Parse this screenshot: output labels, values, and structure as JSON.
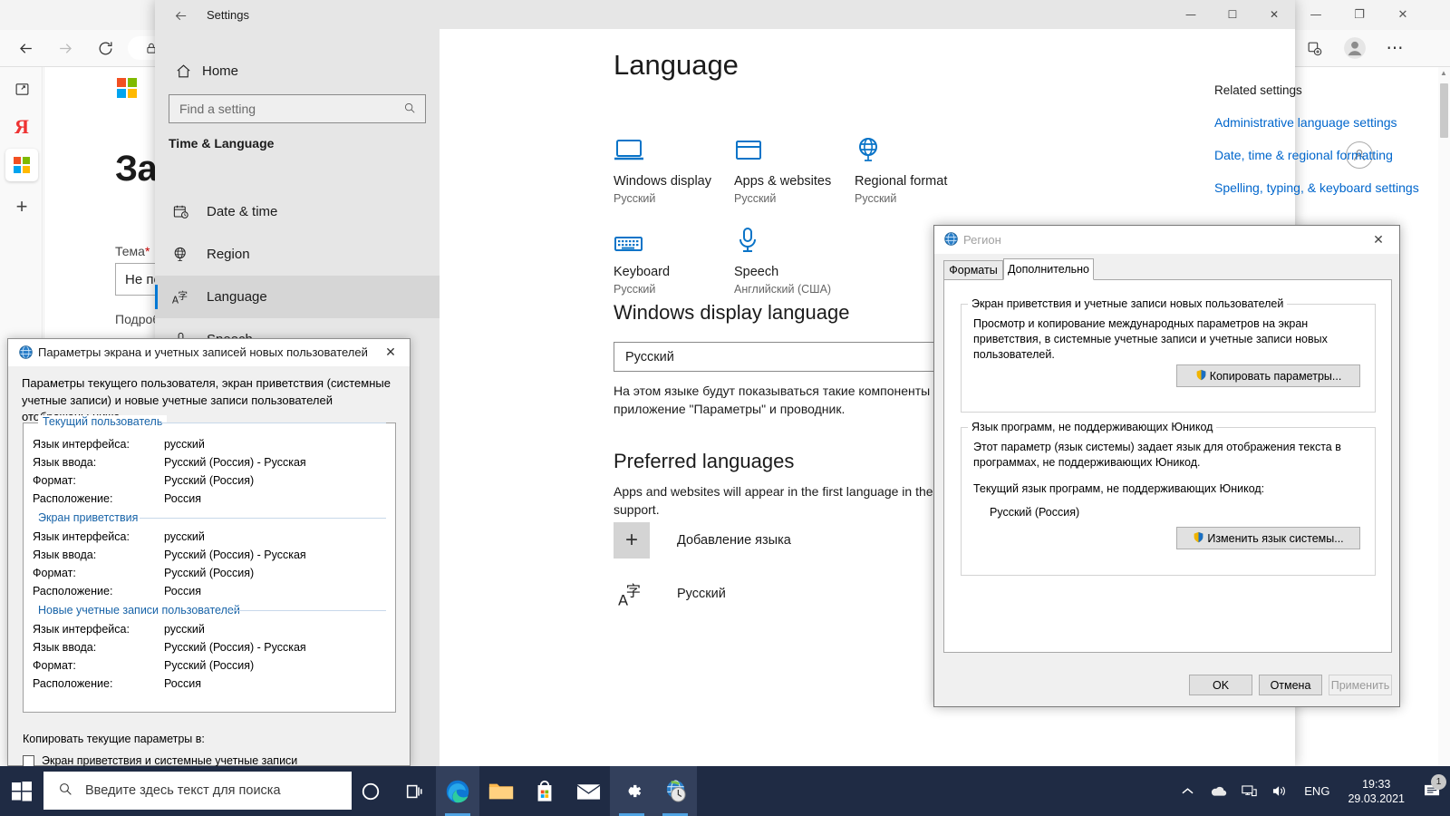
{
  "browser": {
    "back_icon": "back-arrow-icon",
    "forward_icon": "forward-arrow-icon",
    "reload_icon": "reload-icon",
    "lock_icon": "lock-icon",
    "rail": [
      {
        "name": "tab-list-icon",
        "label": ""
      },
      {
        "name": "yandex-tab-icon",
        "label": "Я"
      },
      {
        "name": "microsoft-tab-icon",
        "label": ""
      },
      {
        "name": "new-tab-icon",
        "label": "+"
      }
    ],
    "page": {
      "heading": "Зад",
      "field_label": "Тема",
      "field_required_mark": "*",
      "field_value": "Не по",
      "details_label": "Подроб"
    },
    "collections_icon": "collections-icon",
    "profile_icon": "profile-icon",
    "more_icon": "more-options-icon",
    "minimize": "—",
    "maximize": "❐",
    "close": "✕"
  },
  "settings": {
    "titlebar": {
      "back_label": "←",
      "title": "Settings",
      "minimize": "—",
      "maximize": "☐",
      "close": "✕"
    },
    "sidebar": {
      "home_label": "Home",
      "search_placeholder": "Find a setting",
      "group_header": "Time & Language",
      "items": [
        {
          "label": "Date & time",
          "icon": "calendar-clock-icon",
          "active": false
        },
        {
          "label": "Region",
          "icon": "globe-icon",
          "active": false
        },
        {
          "label": "Language",
          "icon": "language-icon",
          "active": true
        },
        {
          "label": "Speech",
          "icon": "microphone-icon",
          "active": false
        }
      ]
    },
    "page_title": "Language",
    "cards": [
      {
        "name": "Windows display",
        "value": "Русский",
        "icon": "monitor-icon"
      },
      {
        "name": "Apps & websites",
        "value": "Русский",
        "icon": "window-icon"
      },
      {
        "name": "Regional format",
        "value": "Русский",
        "icon": "globe-icon"
      },
      {
        "name": "Keyboard",
        "value": "Русский",
        "icon": "keyboard-icon"
      },
      {
        "name": "Speech",
        "value": "Английский (США)",
        "icon": "microphone-icon"
      }
    ],
    "display_language": {
      "heading": "Windows display language",
      "selected": "Русский",
      "chevron": "chevron-down-icon",
      "description": "На этом языке будут показываться такие компоненты Windows, как приложение \"Параметры\" и проводник."
    },
    "preferred_languages": {
      "heading": "Preferred languages",
      "description": "Apps and websites will appear in the first language in the list that they support.",
      "add_label": "Добавление языка",
      "add_icon": "plus-icon",
      "language_row": {
        "label": "Русский",
        "icon": "language-icon",
        "action_icons": [
          "language-pack-icon",
          "display-language-icon",
          "handwriting-icon",
          "spellcheck-icon"
        ]
      }
    },
    "related": {
      "heading": "Related settings",
      "links": [
        "Administrative language settings",
        "Date, time & regional formatting",
        "Spelling, typing, & keyboard settings"
      ]
    }
  },
  "users_dialog": {
    "title": "Параметры экрана и учетных записей новых пользователей",
    "icon": "region-globe-icon",
    "close": "✕",
    "intro": "Параметры текущего пользователя, экран приветствия (системные учетные записи) и новые учетные записи пользователей отображены ниже.",
    "groups": [
      {
        "title": "Текущий пользователь",
        "rows": [
          {
            "key": "Язык интерфейса:",
            "value": "русский"
          },
          {
            "key": "Язык ввода:",
            "value": "Русский (Россия) - Русская"
          },
          {
            "key": "Формат:",
            "value": "Русский (Россия)"
          },
          {
            "key": "Расположение:",
            "value": "Россия"
          }
        ]
      },
      {
        "title": "Экран приветствия",
        "rows": [
          {
            "key": "Язык интерфейса:",
            "value": "русский"
          },
          {
            "key": "Язык ввода:",
            "value": "Русский (Россия) - Русская"
          },
          {
            "key": "Формат:",
            "value": "Русский (Россия)"
          },
          {
            "key": "Расположение:",
            "value": "Россия"
          }
        ]
      },
      {
        "title": "Новые учетные записи пользователей",
        "rows": [
          {
            "key": "Язык интерфейса:",
            "value": "русский"
          },
          {
            "key": "Язык ввода:",
            "value": "Русский (Россия) - Русская"
          },
          {
            "key": "Формат:",
            "value": "Русский (Россия)"
          },
          {
            "key": "Расположение:",
            "value": "Россия"
          }
        ]
      }
    ],
    "copy_label": "Копировать текущие параметры в:",
    "checkbox_label": "Экран приветствия и системные учетные записи"
  },
  "region_dialog": {
    "title": "Регион",
    "icon": "region-globe-icon",
    "close": "✕",
    "tabs": [
      {
        "label": "Форматы",
        "selected": false
      },
      {
        "label": "Дополнительно",
        "selected": true
      }
    ],
    "group1": {
      "label": "Экран приветствия и учетные записи новых пользователей",
      "text": "Просмотр и копирование международных параметров на экран приветствия, в системные учетные записи и учетные записи новых пользователей.",
      "button": "Копировать параметры...",
      "button_icon": "uac-shield-icon"
    },
    "group2": {
      "label": "Язык программ, не поддерживающих Юникод",
      "text": "Этот параметр (язык системы) задает язык для отображения текста в программах, не поддерживающих Юникод.",
      "current_label": "Текущий язык программ, не поддерживающих Юникод:",
      "current_value": "Русский (Россия)",
      "button": "Изменить язык системы...",
      "button_icon": "uac-shield-icon"
    },
    "footer": {
      "ok": "OK",
      "cancel": "Отмена",
      "apply": "Применить"
    }
  },
  "taskbar": {
    "start_icon": "windows-start-icon",
    "search_placeholder": "Введите здесь текст для поиска",
    "search_icon": "search-icon",
    "apps": [
      {
        "name": "cortana-icon",
        "active": false
      },
      {
        "name": "task-view-icon",
        "active": false
      },
      {
        "name": "edge-icon",
        "active": true
      },
      {
        "name": "file-explorer-icon",
        "active": false
      },
      {
        "name": "microsoft-store-icon",
        "active": false
      },
      {
        "name": "mail-icon",
        "active": false
      },
      {
        "name": "settings-icon",
        "active": true
      },
      {
        "name": "region-control-panel-icon",
        "active": true
      }
    ],
    "tray": {
      "chevron": "show-hidden-icons-icon",
      "onedrive": "onedrive-icon",
      "network": "network-icon",
      "volume": "volume-icon",
      "language": "ENG",
      "time": "19:33",
      "date": "29.03.2021",
      "notification_icon": "action-center-icon",
      "notification_count": "1"
    }
  },
  "colors": {
    "accent": "#0078d4",
    "link": "#0066cc",
    "taskbar": "#1f2b44",
    "settings_sidebar": "#e6e6e6"
  }
}
